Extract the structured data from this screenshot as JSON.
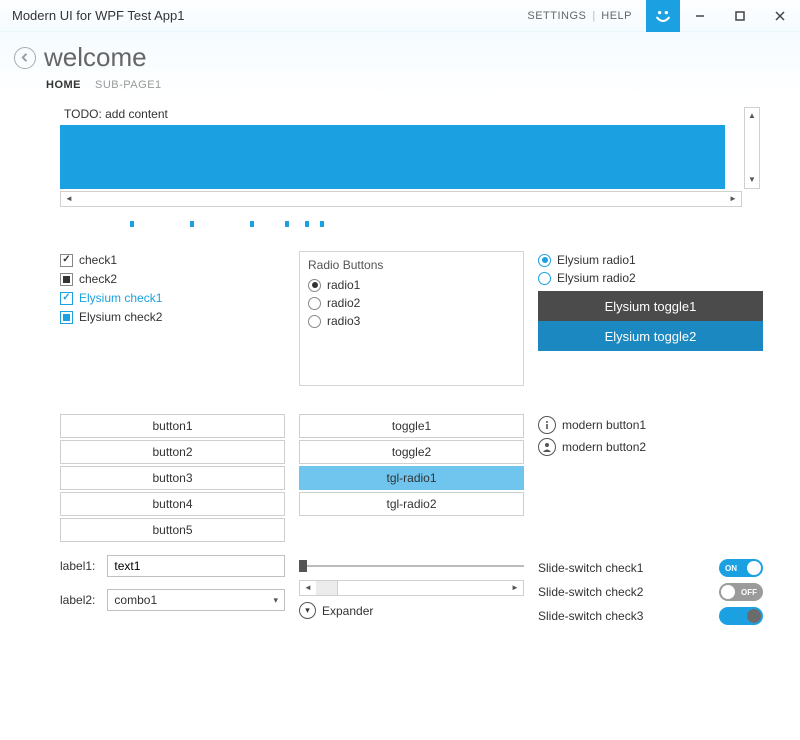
{
  "colors": {
    "accent": "#1ba1e2"
  },
  "titlebar": {
    "title": "Modern UI for WPF Test App1",
    "settings": "SETTINGS",
    "help": "HELP"
  },
  "header": {
    "title": "welcome",
    "crumbs": {
      "home": "HOME",
      "sub1": "SUB-PAGE1"
    }
  },
  "todo": "TODO: add content",
  "checks": {
    "c1": "check1",
    "c2": "check2",
    "e1": "Elysium check1",
    "e2": "Elysium check2"
  },
  "radiobox": {
    "legend": "Radio Buttons",
    "r1": "radio1",
    "r2": "radio2",
    "r3": "radio3"
  },
  "eradios": {
    "r1": "Elysium radio1",
    "r2": "Elysium radio2"
  },
  "etoggles": {
    "t1": "Elysium toggle1",
    "t2": "Elysium toggle2"
  },
  "buttons": {
    "b1": "button1",
    "b2": "button2",
    "b3": "button3",
    "b4": "button4",
    "b5": "button5"
  },
  "toggles": {
    "t1": "toggle1",
    "t2": "toggle2",
    "tr1": "tgl-radio1",
    "tr2": "tgl-radio2"
  },
  "modbtn": {
    "m1": "modern button1",
    "m2": "modern button2"
  },
  "form": {
    "label1": "label1:",
    "text1": "text1",
    "label2": "label2:",
    "combo1": "combo1"
  },
  "expander": "Expander",
  "switches": {
    "s1": "Slide-switch check1",
    "s2": "Slide-switch check2",
    "s3": "Slide-switch check3",
    "on": "ON",
    "off": "OFF"
  }
}
